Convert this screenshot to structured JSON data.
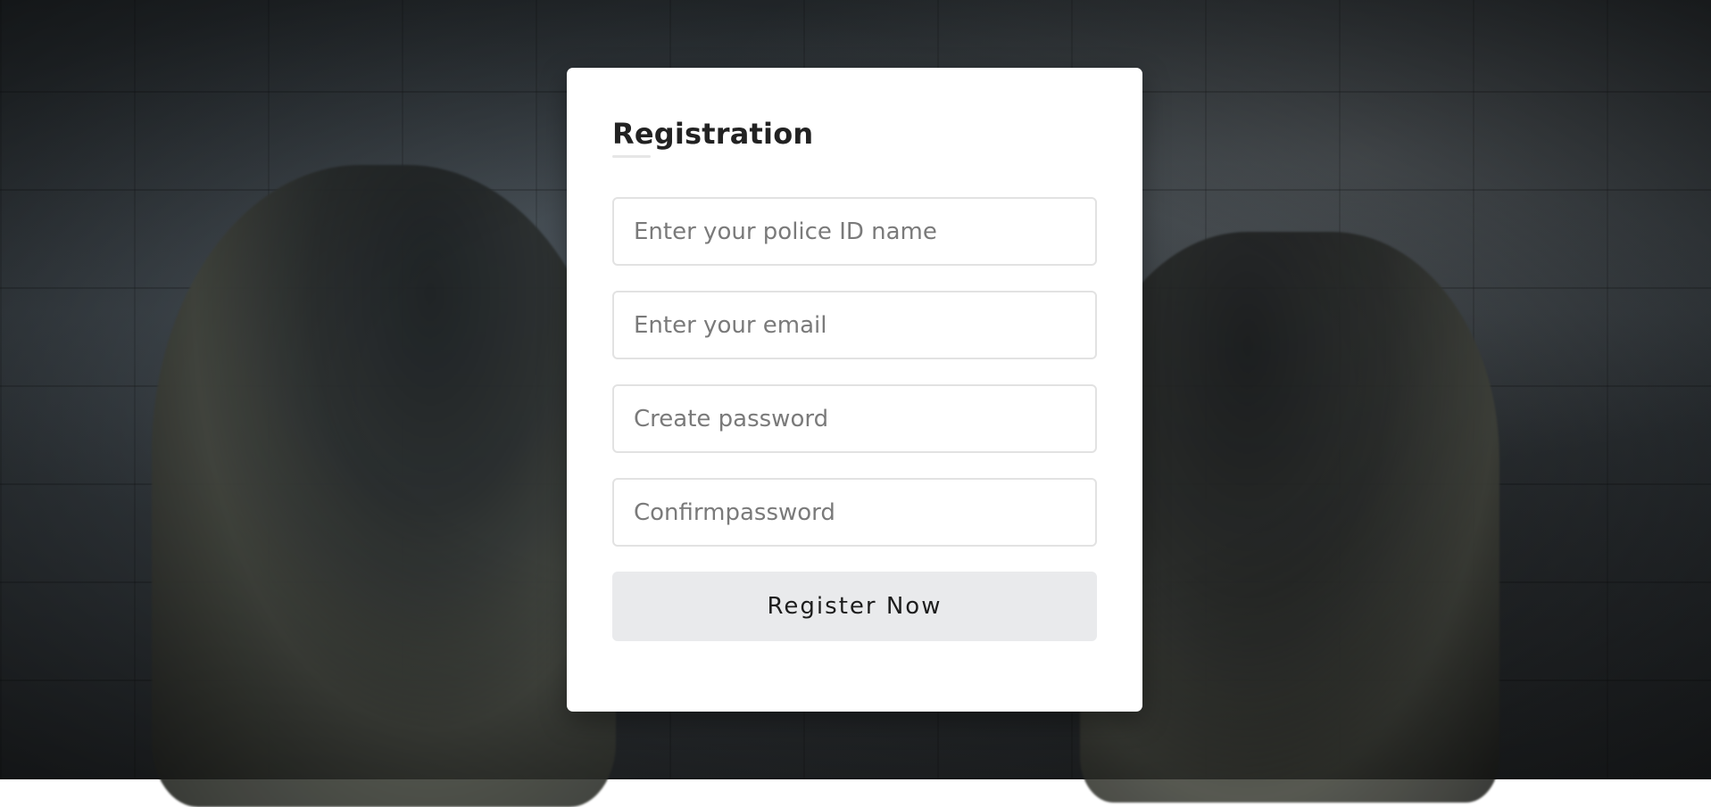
{
  "form": {
    "title": "Registration",
    "fields": [
      {
        "placeholder": "Enter your police ID name",
        "value": ""
      },
      {
        "placeholder": "Enter your email",
        "value": ""
      },
      {
        "placeholder": "Create password",
        "value": ""
      },
      {
        "placeholder": "Confirmpassword",
        "value": ""
      }
    ],
    "submit_label": "Register Now"
  },
  "colors": {
    "card_background": "#ffffff",
    "button_background": "#e9eaec",
    "field_border": "#e2e2e2",
    "title_text": "#222222"
  }
}
